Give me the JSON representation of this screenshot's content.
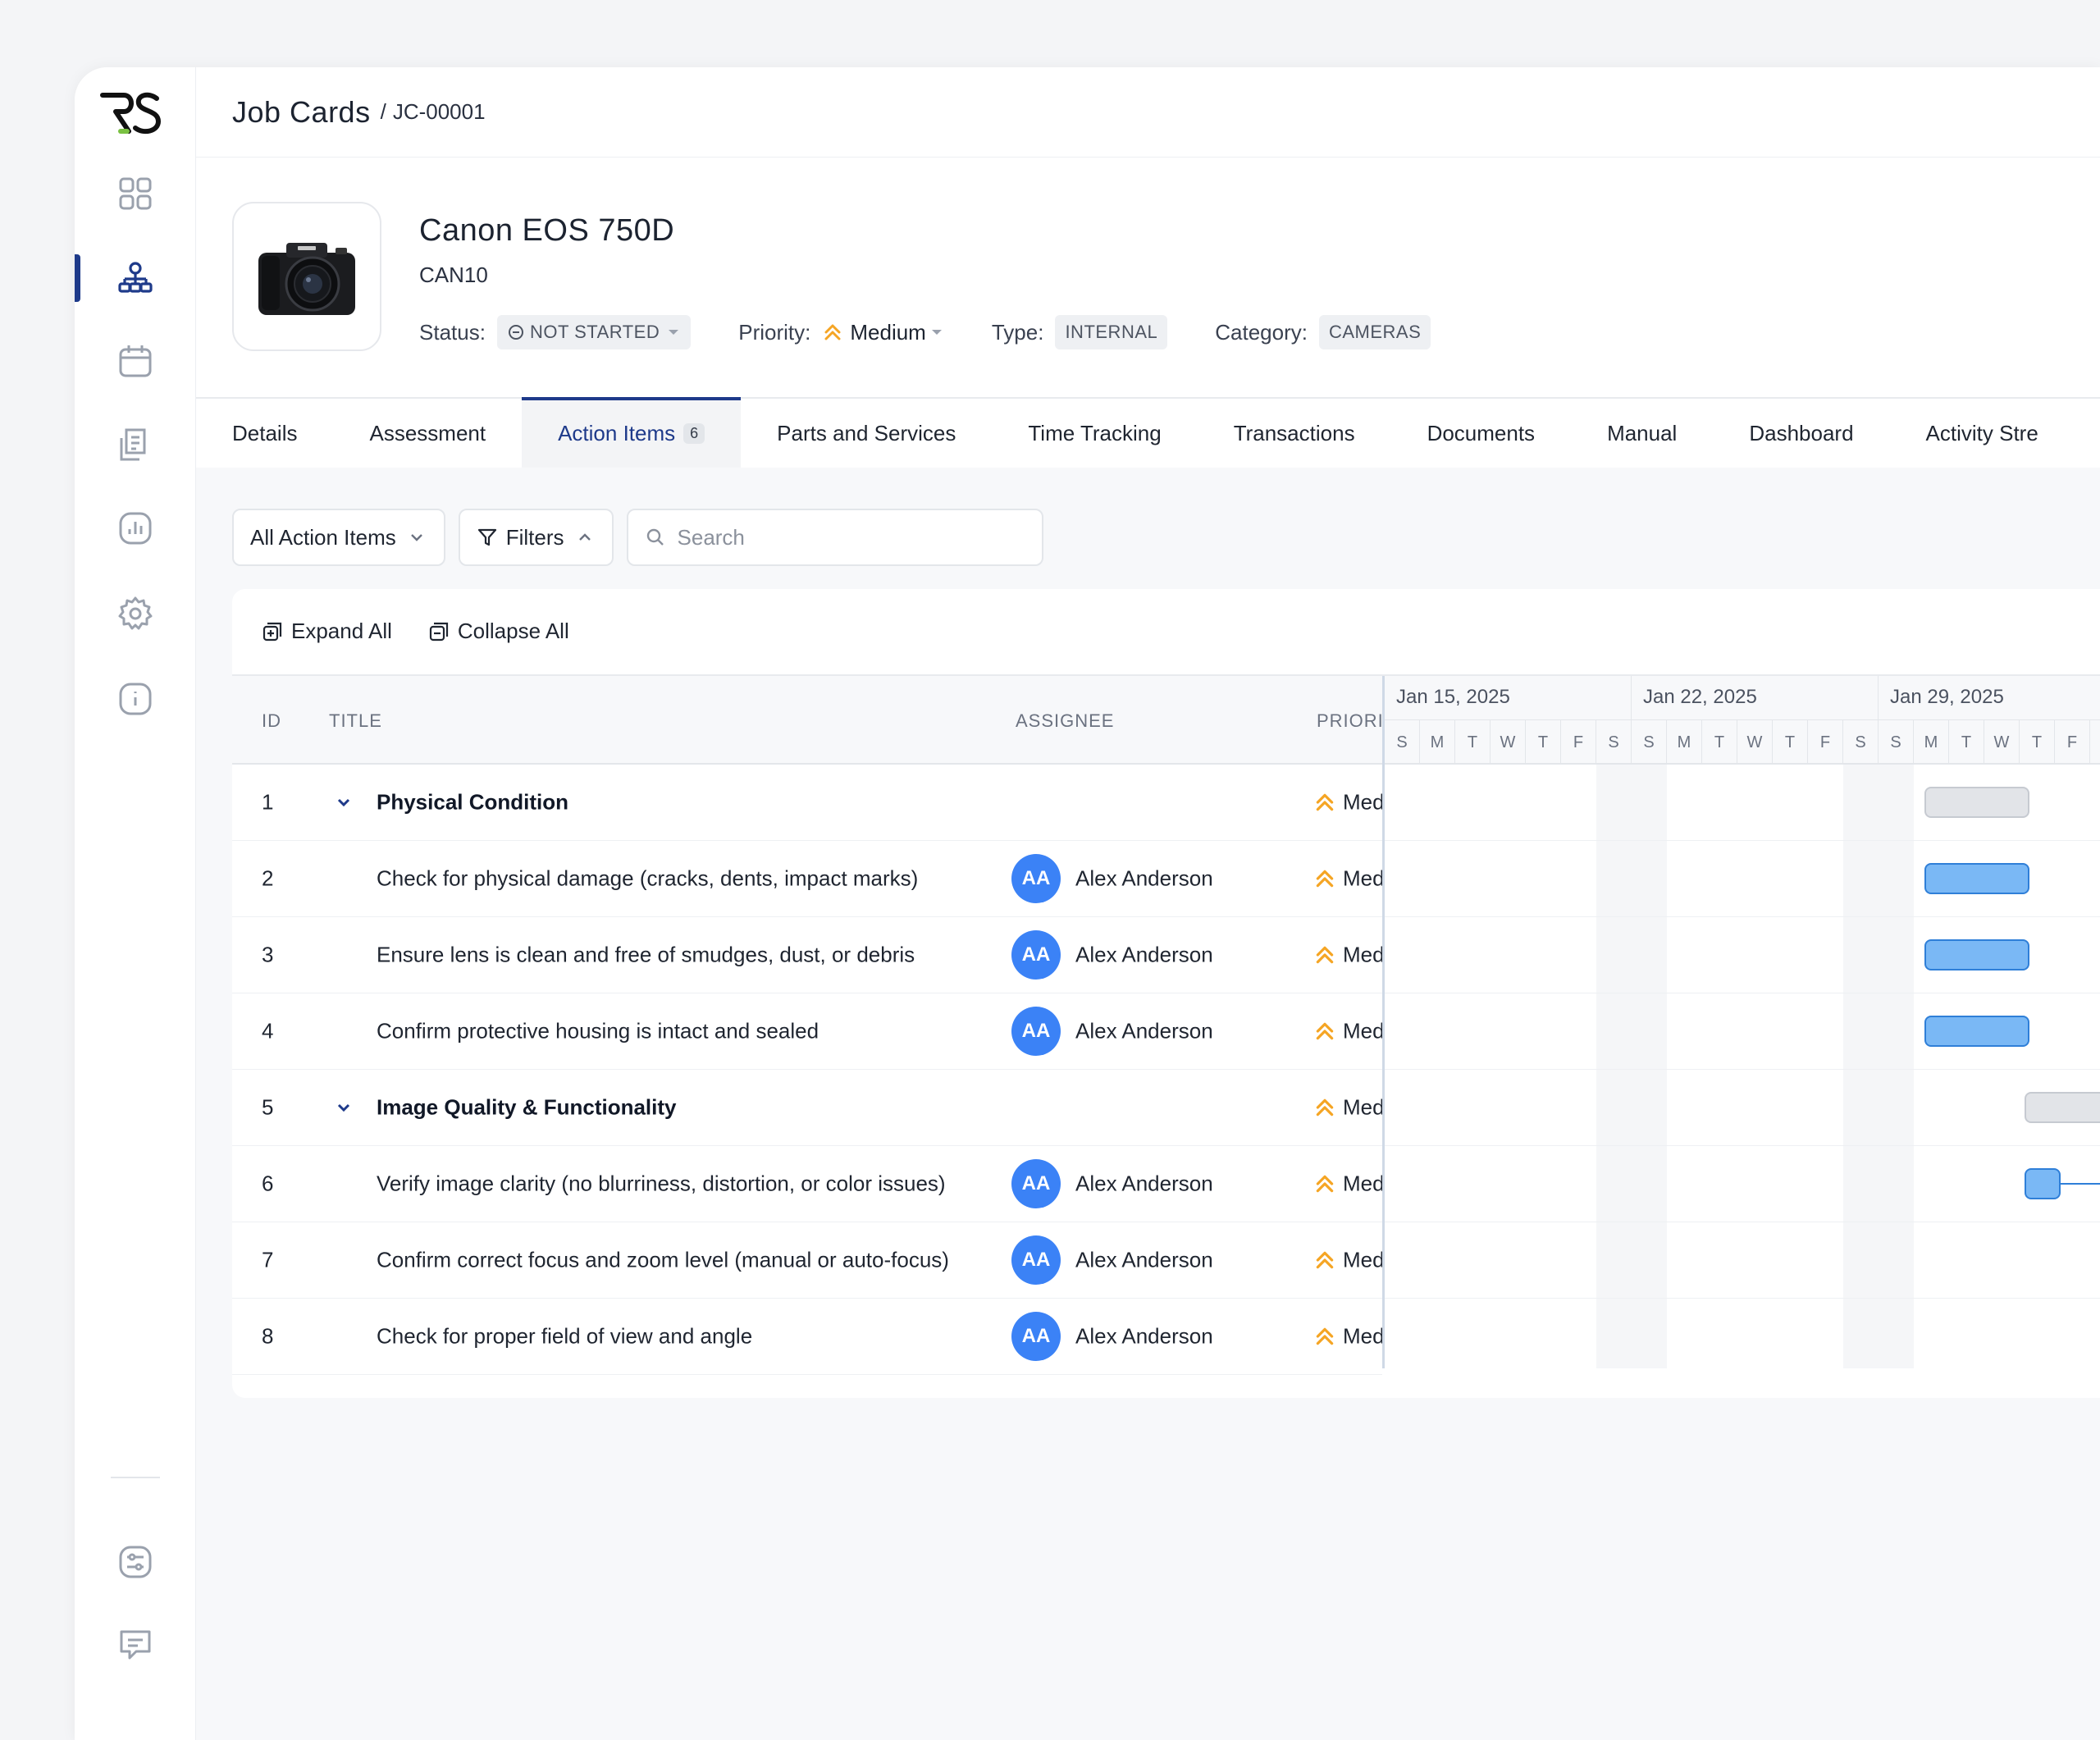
{
  "breadcrumb": {
    "section": "Job Cards",
    "separator": "/",
    "record": "JC-00001"
  },
  "product": {
    "name": "Canon EOS 750D",
    "code": "CAN10",
    "status_label": "Status:",
    "status_value": "NOT STARTED",
    "priority_label": "Priority:",
    "priority_value": "Medium",
    "type_label": "Type:",
    "type_value": "INTERNAL",
    "category_label": "Category:",
    "category_value": "CAMERAS"
  },
  "tabs": [
    {
      "label": "Details"
    },
    {
      "label": "Assessment"
    },
    {
      "label": "Action Items",
      "count": "6",
      "active": true
    },
    {
      "label": "Parts and Services"
    },
    {
      "label": "Time Tracking"
    },
    {
      "label": "Transactions"
    },
    {
      "label": "Documents"
    },
    {
      "label": "Manual"
    },
    {
      "label": "Dashboard"
    },
    {
      "label": "Activity Stre"
    }
  ],
  "toolbar": {
    "view_select": "All Action Items",
    "filters_label": "Filters",
    "search_placeholder": "Search"
  },
  "grid": {
    "expand_all": "Expand All",
    "collapse_all": "Collapse All",
    "columns": {
      "id": "ID",
      "title": "TITLE",
      "assignee": "ASSIGNEE",
      "priority": "PRIORI"
    },
    "rows": [
      {
        "id": "1",
        "title": "Physical Condition",
        "group": true,
        "assignee": "",
        "initials": "",
        "priority": "Med"
      },
      {
        "id": "2",
        "title": "Check for physical damage (cracks, dents, impact marks)",
        "group": false,
        "assignee": "Alex Anderson",
        "initials": "AA",
        "priority": "Med"
      },
      {
        "id": "3",
        "title": "Ensure lens is clean and free of smudges, dust, or debris",
        "group": false,
        "assignee": "Alex Anderson",
        "initials": "AA",
        "priority": "Med"
      },
      {
        "id": "4",
        "title": "Confirm protective housing is intact and sealed",
        "group": false,
        "assignee": "Alex Anderson",
        "initials": "AA",
        "priority": "Med"
      },
      {
        "id": "5",
        "title": "Image Quality & Functionality",
        "group": true,
        "assignee": "",
        "initials": "",
        "priority": "Med"
      },
      {
        "id": "6",
        "title": "Verify image clarity (no blurriness, distortion, or color issues)",
        "group": false,
        "assignee": "Alex Anderson",
        "initials": "AA",
        "priority": "Med"
      },
      {
        "id": "7",
        "title": "Confirm correct focus and zoom level (manual or auto-focus)",
        "group": false,
        "assignee": "Alex Anderson",
        "initials": "AA",
        "priority": "Med"
      },
      {
        "id": "8",
        "title": "Check for proper field of view and angle",
        "group": false,
        "assignee": "Alex Anderson",
        "initials": "AA",
        "priority": "Med"
      }
    ]
  },
  "gantt": {
    "weeks": [
      "Jan 15, 2025",
      "Jan 22, 2025",
      "Jan 29, 2025"
    ],
    "days": [
      "S",
      "M",
      "T",
      "W",
      "T",
      "F",
      "S",
      "S",
      "M",
      "T",
      "W",
      "T",
      "F",
      "S",
      "S",
      "M",
      "T",
      "W",
      "T",
      "F"
    ]
  },
  "colors": {
    "accent": "#1e3a8a",
    "avatar": "#3b82f6",
    "priority": "#f5a524",
    "bar_blue": "#7ab8f5"
  },
  "icons": {
    "sidebar": [
      "dashboard-icon",
      "org-chart-icon",
      "calendar-icon",
      "document-icon",
      "reports-icon",
      "settings-icon",
      "info-icon",
      "preferences-icon",
      "chat-icon"
    ]
  }
}
